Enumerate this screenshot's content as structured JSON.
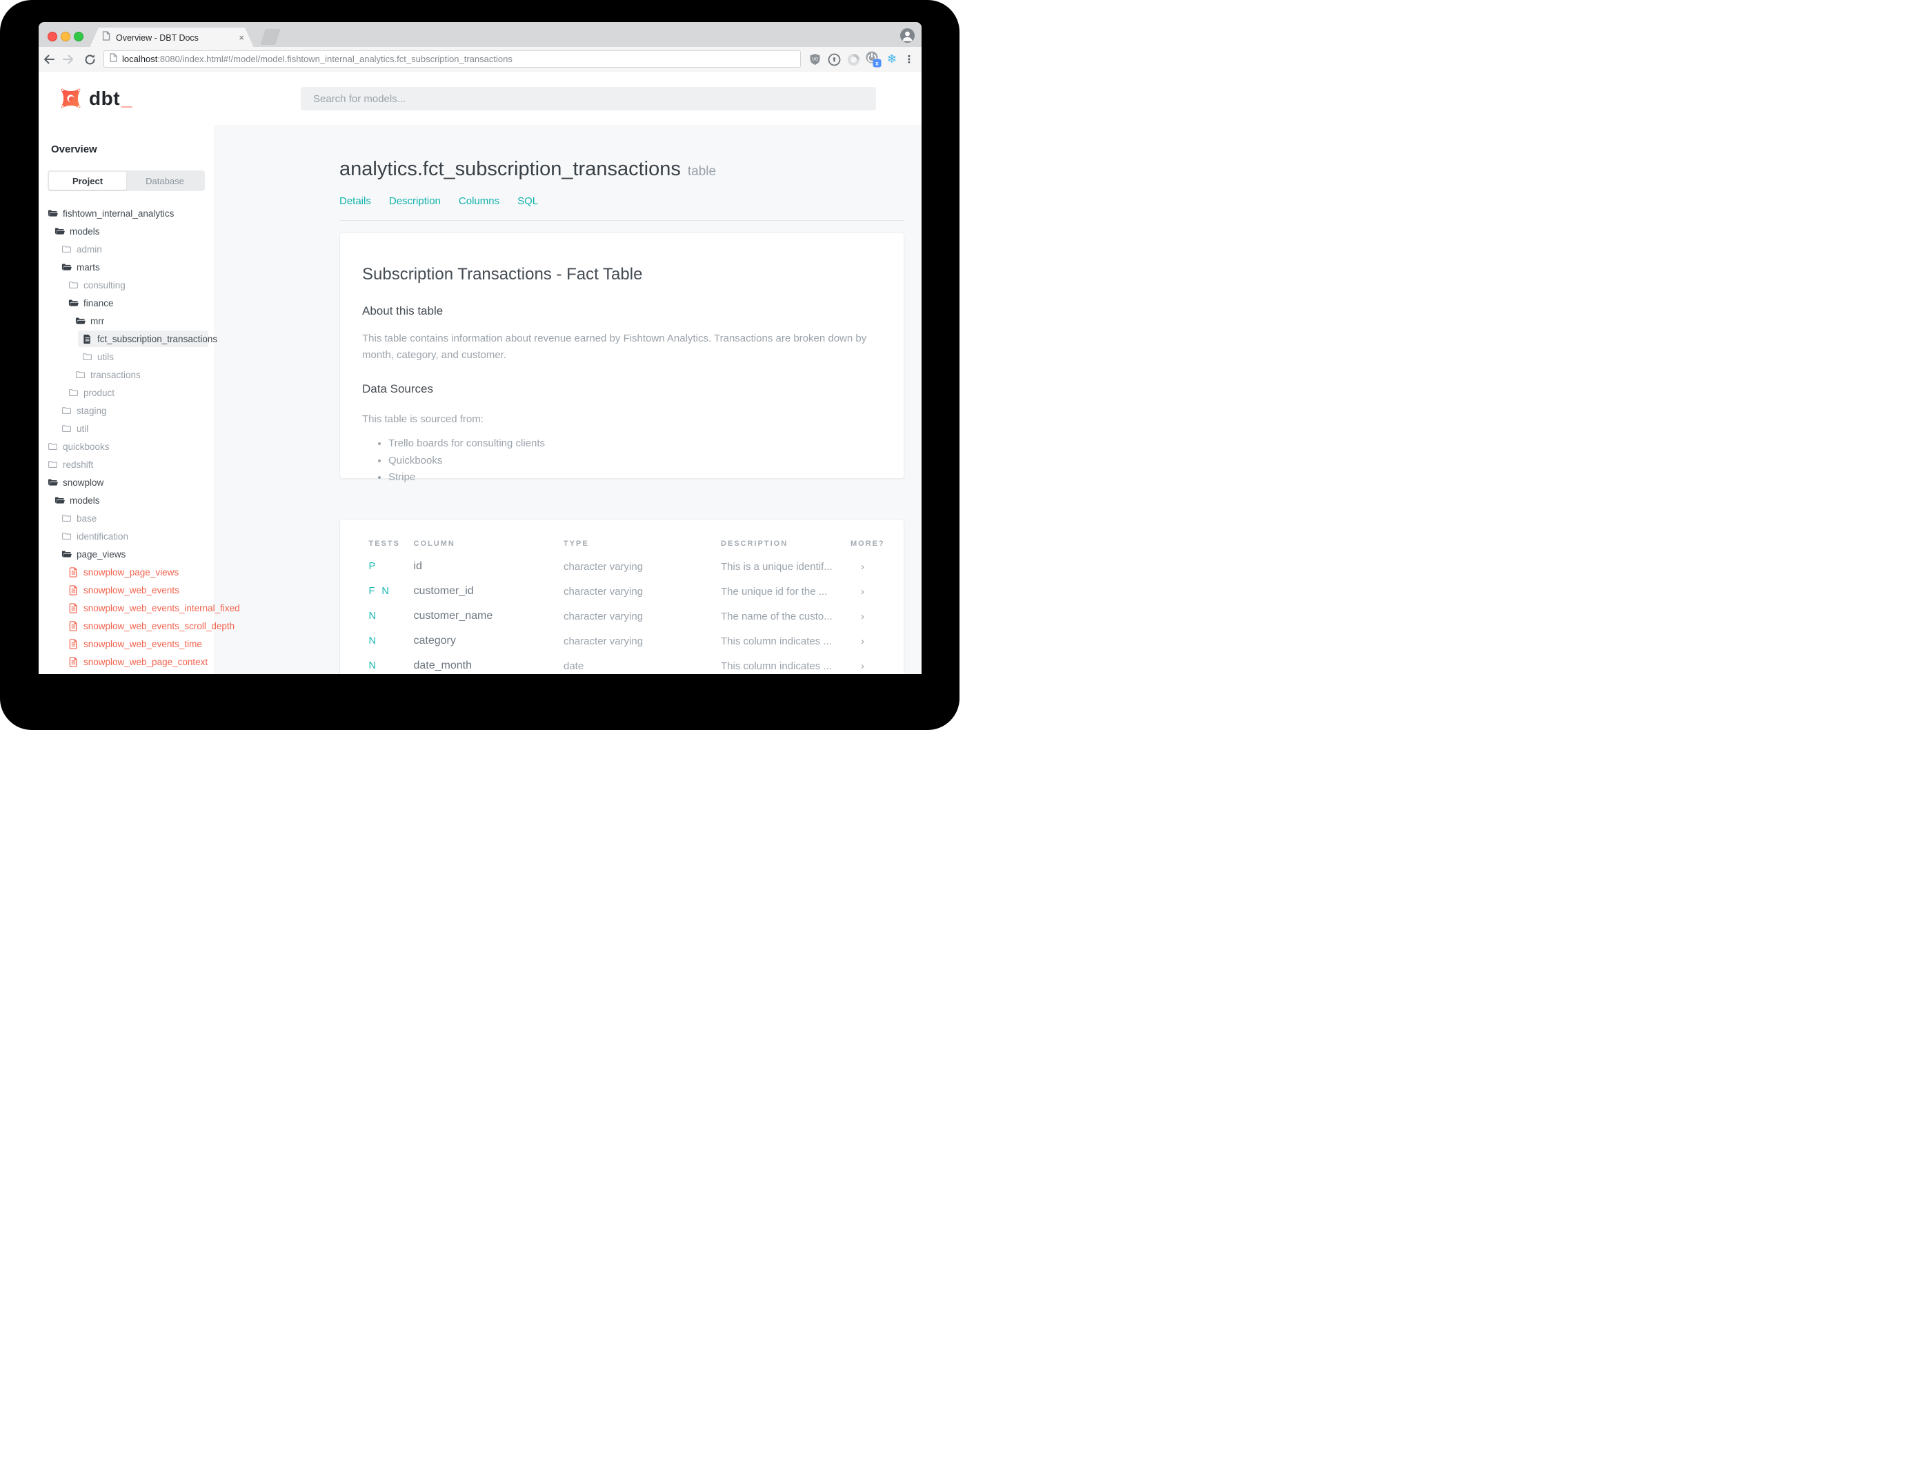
{
  "colors": {
    "accent_teal": "#12b4ba",
    "accent_red": "#f2624d",
    "logo_orange": "#ff5c4b",
    "traffic_red": "#fc5753",
    "traffic_yellow": "#fdbc40",
    "traffic_green": "#33c748"
  },
  "browser": {
    "tab_title": "Overview - DBT Docs",
    "tab_close": "×",
    "url_host": "localhost",
    "url_rest": ":8080/index.html#!/model/model.fishtown_internal_analytics.fct_subscription_transactions",
    "menu_dots": "⋮",
    "snowflake": "❄"
  },
  "header": {
    "logo_text": "dbt",
    "logo_underscore": "_",
    "search_placeholder": "Search for models..."
  },
  "sidebar": {
    "heading": "Overview",
    "tabs": [
      {
        "label": "Project",
        "active": true
      },
      {
        "label": "Database",
        "active": false
      }
    ],
    "tree": [
      {
        "label": "fishtown_internal_analytics",
        "level": 0,
        "kind": "folder-open",
        "tone": "dark"
      },
      {
        "label": "models",
        "level": 1,
        "kind": "folder-open",
        "tone": "dark"
      },
      {
        "label": "admin",
        "level": 2,
        "kind": "folder",
        "tone": "muted"
      },
      {
        "label": "marts",
        "level": 2,
        "kind": "folder-open",
        "tone": "dark"
      },
      {
        "label": "consulting",
        "level": 3,
        "kind": "folder",
        "tone": "muted"
      },
      {
        "label": "finance",
        "level": 3,
        "kind": "folder-open",
        "tone": "dark"
      },
      {
        "label": "mrr",
        "level": 4,
        "kind": "folder-open",
        "tone": "dark"
      },
      {
        "label": "fct_subscription_transactions",
        "level": 5,
        "kind": "file",
        "tone": "dark",
        "selected": true
      },
      {
        "label": "utils",
        "level": 5,
        "kind": "folder",
        "tone": "muted"
      },
      {
        "label": "transactions",
        "level": 4,
        "kind": "folder",
        "tone": "muted"
      },
      {
        "label": "product",
        "level": 3,
        "kind": "folder",
        "tone": "muted"
      },
      {
        "label": "staging",
        "level": 2,
        "kind": "folder",
        "tone": "muted"
      },
      {
        "label": "util",
        "level": 2,
        "kind": "folder",
        "tone": "muted"
      },
      {
        "label": "quickbooks",
        "level": 0,
        "kind": "folder",
        "tone": "muted"
      },
      {
        "label": "redshift",
        "level": 0,
        "kind": "folder",
        "tone": "muted"
      },
      {
        "label": "snowplow",
        "level": 0,
        "kind": "folder-open",
        "tone": "dark"
      },
      {
        "label": "models",
        "level": 1,
        "kind": "folder-open",
        "tone": "dark"
      },
      {
        "label": "base",
        "level": 2,
        "kind": "folder",
        "tone": "muted"
      },
      {
        "label": "identification",
        "level": 2,
        "kind": "folder",
        "tone": "muted"
      },
      {
        "label": "page_views",
        "level": 2,
        "kind": "folder-open",
        "tone": "dark"
      },
      {
        "label": "snowplow_page_views",
        "level": 3,
        "kind": "file-red",
        "tone": "red"
      },
      {
        "label": "snowplow_web_events",
        "level": 3,
        "kind": "file-red",
        "tone": "red"
      },
      {
        "label": "snowplow_web_events_internal_fixed",
        "level": 3,
        "kind": "file-red",
        "tone": "red"
      },
      {
        "label": "snowplow_web_events_scroll_depth",
        "level": 3,
        "kind": "file-red",
        "tone": "red"
      },
      {
        "label": "snowplow_web_events_time",
        "level": 3,
        "kind": "file-red",
        "tone": "red"
      },
      {
        "label": "snowplow_web_page_context",
        "level": 3,
        "kind": "file-red",
        "tone": "red"
      }
    ]
  },
  "main": {
    "title": "analytics.fct_subscription_transactions",
    "title_badge": "table",
    "nav": [
      "Details",
      "Description",
      "Columns",
      "SQL"
    ],
    "description_label": "Description",
    "doc": {
      "title": "Subscription Transactions - Fact Table",
      "about_heading": "About this table",
      "about_body": "This table contains information about revenue earned by Fishtown Analytics. Transactions are broken down by month, category, and customer.",
      "sources_heading": "Data Sources",
      "sources_intro": "This table is sourced from:",
      "sources": [
        "Trello boards for consulting clients",
        "Quickbooks",
        "Stripe"
      ]
    },
    "columns_label": "Columns",
    "table": {
      "headers": [
        "TESTS",
        "COLUMN",
        "TYPE",
        "DESCRIPTION",
        "MORE?"
      ],
      "rows": [
        {
          "tests": "P",
          "column": "id",
          "type": "character varying",
          "description": "This is a unique identif...",
          "more": "›"
        },
        {
          "tests": "F N",
          "column": "customer_id",
          "type": "character varying",
          "description": "The unique id for the ...",
          "more": "›"
        },
        {
          "tests": "N",
          "column": "customer_name",
          "type": "character varying",
          "description": "The name of the custo...",
          "more": "›"
        },
        {
          "tests": "N",
          "column": "category",
          "type": "character varying",
          "description": "This column indicates ...",
          "more": "›"
        },
        {
          "tests": "N",
          "column": "date_month",
          "type": "date",
          "description": "This column indicates ...",
          "more": "›"
        }
      ]
    }
  }
}
